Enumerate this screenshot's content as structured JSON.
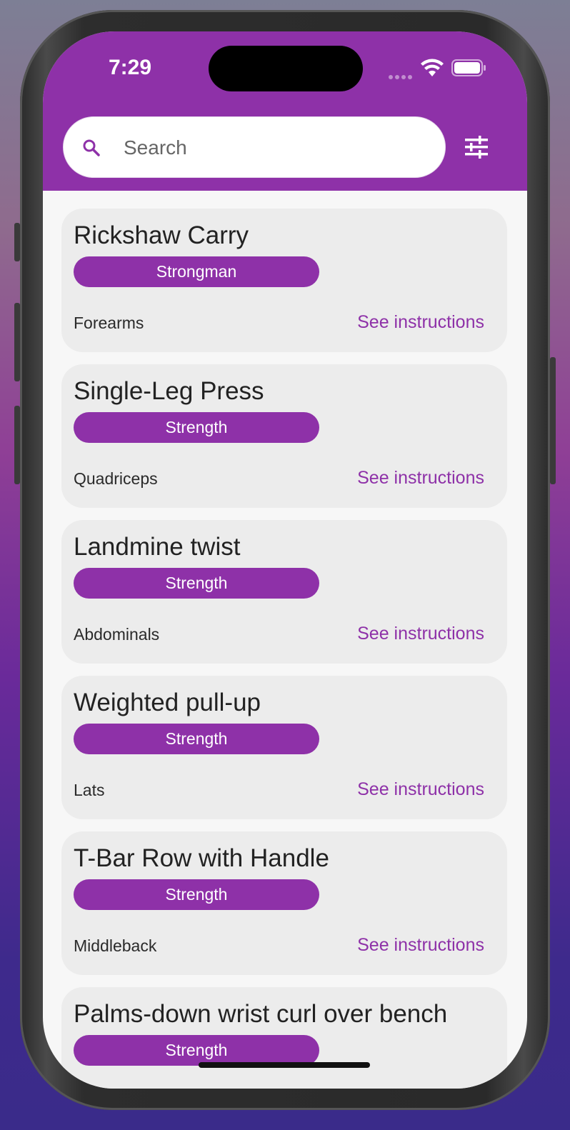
{
  "status_bar": {
    "time": "7:29"
  },
  "search": {
    "placeholder": "Search",
    "value": ""
  },
  "exercises": [
    {
      "name": "Rickshaw Carry",
      "type": "Strongman",
      "muscle": "Forearms",
      "action": "See instructions"
    },
    {
      "name": "Single-Leg Press",
      "type": "Strength",
      "muscle": "Quadriceps",
      "action": "See instructions"
    },
    {
      "name": "Landmine twist",
      "type": "Strength",
      "muscle": "Abdominals",
      "action": "See instructions"
    },
    {
      "name": "Weighted pull-up",
      "type": "Strength",
      "muscle": "Lats",
      "action": "See instructions"
    },
    {
      "name": "T-Bar Row with Handle",
      "type": "Strength",
      "muscle": "Middleback",
      "action": "See instructions"
    },
    {
      "name": "Palms-down wrist curl over bench",
      "type": "Strength",
      "muscle": "",
      "action": ""
    }
  ],
  "colors": {
    "primary": "#8e31a8",
    "card": "#ececec",
    "background": "#f7f7f7"
  },
  "icons": {
    "search": "search-icon",
    "filter": "tune-icon",
    "wifi": "wifi-icon",
    "battery": "battery-icon"
  }
}
